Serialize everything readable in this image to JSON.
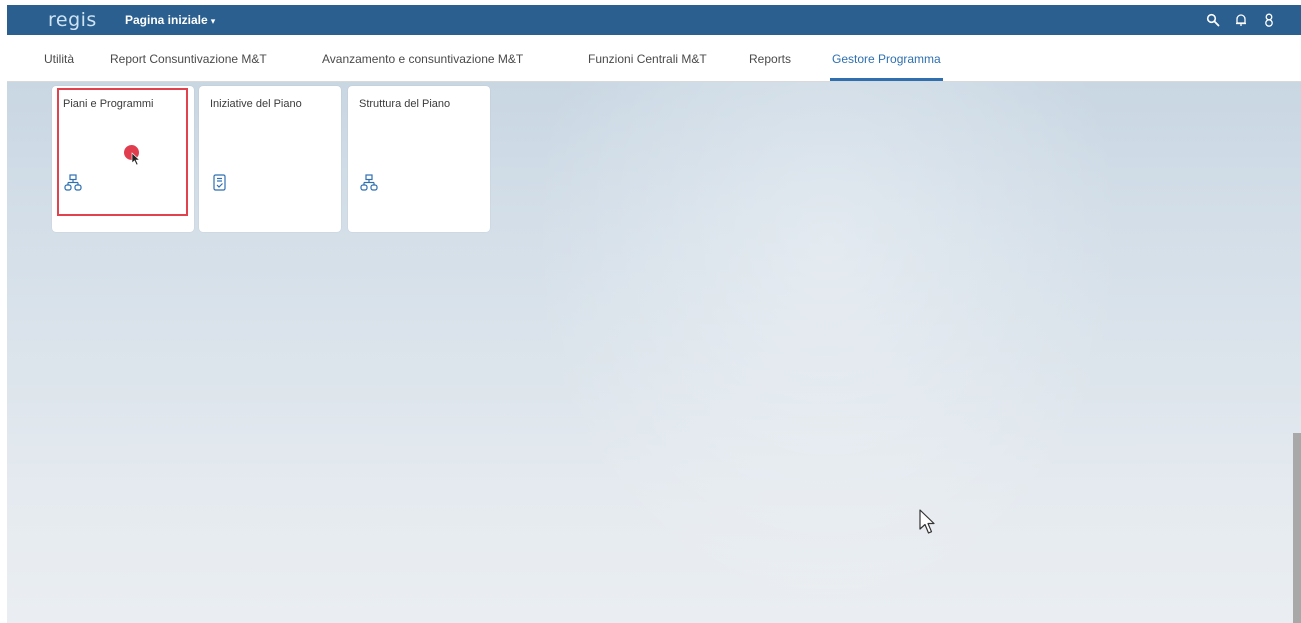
{
  "header": {
    "logo": "regis",
    "home_menu": "Pagina iniziale",
    "caret": "▾",
    "icons": [
      "search-icon",
      "bell-icon",
      "user-icon"
    ],
    "color": "#2a5f8f"
  },
  "tabs": [
    {
      "label": "Utilità",
      "active": false
    },
    {
      "label": "Report Consuntivazione M&T",
      "active": false
    },
    {
      "label": "Avanzamento e consuntivazione M&T",
      "active": false
    },
    {
      "label": "Funzioni Centrali M&T",
      "active": false
    },
    {
      "label": "Reports",
      "active": false
    },
    {
      "label": "Gestore Programma",
      "active": true
    }
  ],
  "tiles": [
    {
      "title": "Piani e Programmi",
      "icon": "hierarchy-icon",
      "highlighted": true
    },
    {
      "title": "Iniziative del Piano",
      "icon": "checklist-document-icon",
      "highlighted": false
    },
    {
      "title": "Struttura del Piano",
      "icon": "hierarchy-icon",
      "highlighted": false
    }
  ],
  "colors": {
    "accent": "#2d6fb1",
    "highlight": "#e0424e",
    "icon": "#2d6fb1"
  }
}
